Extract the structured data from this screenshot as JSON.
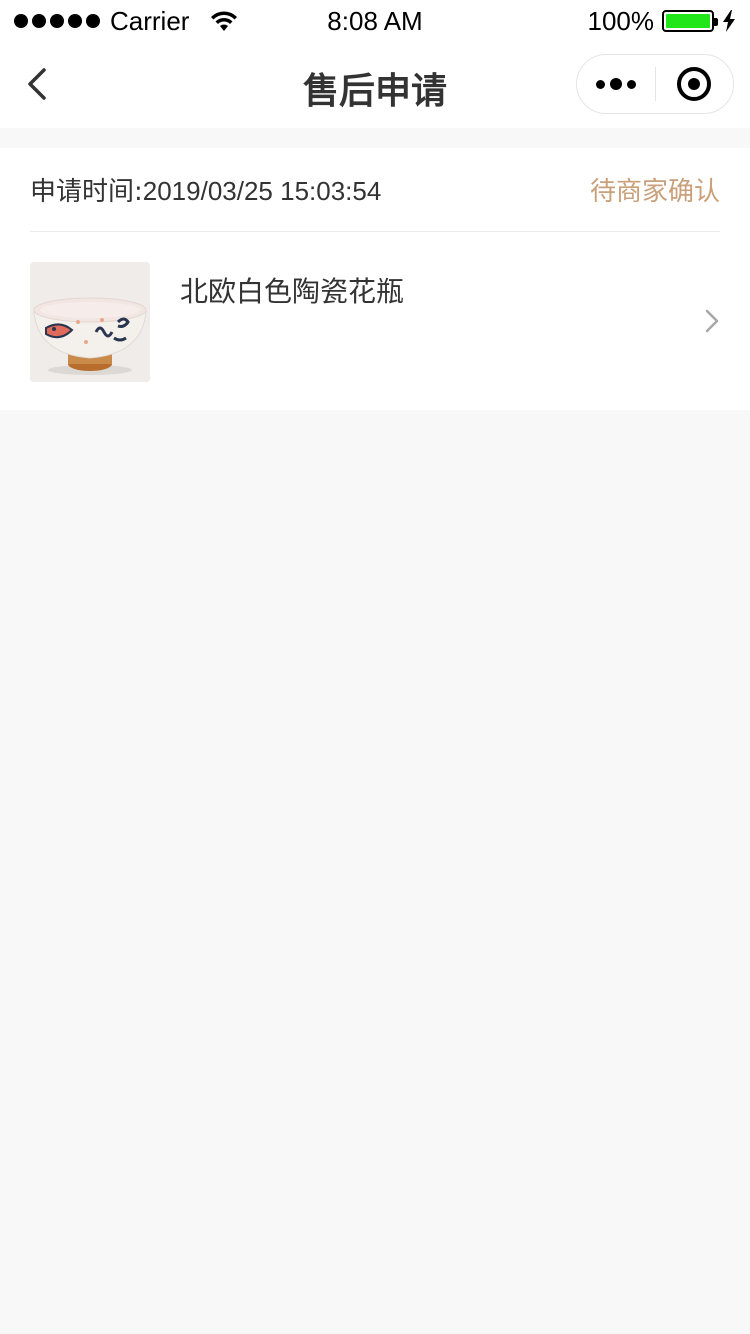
{
  "status_bar": {
    "carrier": "Carrier",
    "time": "8:08 AM",
    "battery_percent": "100%",
    "battery_level": 1.0,
    "battery_color": "#22e51a"
  },
  "nav": {
    "title": "售后申请",
    "back_icon": "chevron-left-icon",
    "more_icon": "more-dots-icon",
    "close_icon": "target-circle-icon"
  },
  "request": {
    "time_label": "申请时间:",
    "time_value": "2019/03/25 15:03:54",
    "status": "待商家确认",
    "status_color": "#c9a07a",
    "product": {
      "name": "北欧白色陶瓷花瓶",
      "image_icon": "ceramic-bowl-thumbnail"
    },
    "chevron_icon": "chevron-right-icon"
  }
}
